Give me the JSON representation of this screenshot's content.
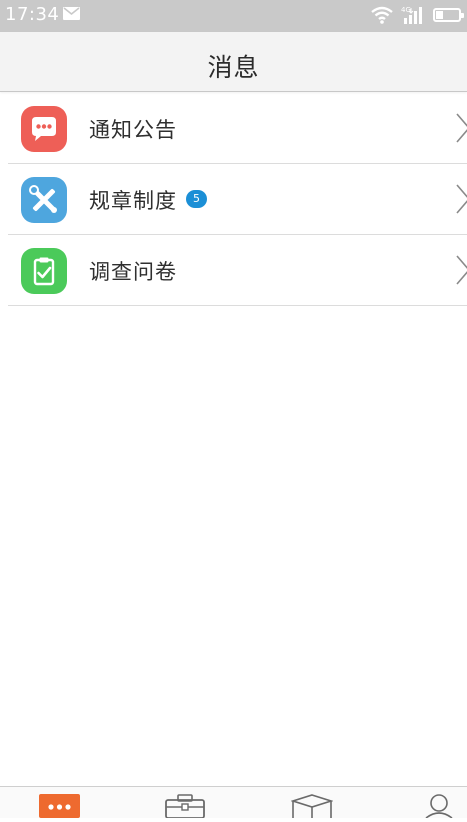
{
  "status_bar": {
    "time": "17:34",
    "icons": [
      "mail-icon",
      "wifi-icon",
      "signal-4g-icon",
      "battery-icon"
    ]
  },
  "header": {
    "title": "消息"
  },
  "messages": [
    {
      "label": "通知公告",
      "icon": "chat-bubble-icon",
      "color": "#ee5f57",
      "badge": null
    },
    {
      "label": "规章制度",
      "icon": "tools-icon",
      "color": "#4ea6de",
      "badge": "5"
    },
    {
      "label": "调查问卷",
      "icon": "clipboard-check-icon",
      "color": "#4bca5a",
      "badge": null
    }
  ],
  "tab_bar": {
    "tabs": [
      {
        "icon": "messages-icon",
        "active": true
      },
      {
        "icon": "briefcase-icon",
        "active": false
      },
      {
        "icon": "box-icon",
        "active": false
      },
      {
        "icon": "profile-icon",
        "active": false
      }
    ],
    "accent_color": "#ee6a2f"
  }
}
